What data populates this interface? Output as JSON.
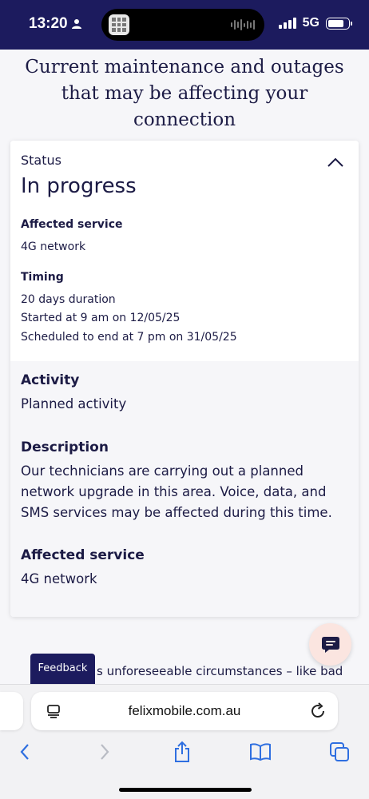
{
  "status_bar": {
    "time": "13:20",
    "network": "5G"
  },
  "page": {
    "heading": "Current maintenance and outages that may be affecting your connection"
  },
  "card": {
    "status_label": "Status",
    "status_value": "In progress",
    "affected_service_label": "Affected service",
    "affected_service_value": "4G network",
    "timing_label": "Timing",
    "timing_lines": [
      "20 days duration",
      "Started at 9 am on 12/05/25",
      "Scheduled to end at 7 pm on 31/05/25"
    ],
    "activity_label": "Activity",
    "activity_value": "Planned activity",
    "description_label": "Description",
    "description_text": "Our technicians are carrying out a planned network upgrade in this area. Voice, data, and SMS services may be affected during this time.",
    "affected_service_label_2": "Affected service",
    "affected_service_value_2": "4G network"
  },
  "footer": {
    "cut_text": "s unforeseeable circumstances – like bad",
    "feedback_label": "Feedback"
  },
  "browser": {
    "url": "felixmobile.com.au"
  },
  "colors": {
    "navy": "#1c1b5e",
    "chat_bg": "#fbe5e0"
  }
}
